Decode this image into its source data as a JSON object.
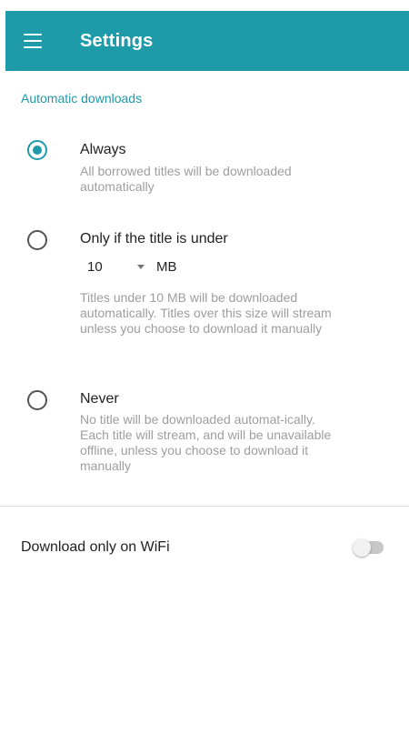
{
  "app_bar": {
    "title": "Settings",
    "background": "#1e9aa9",
    "menu_icon": "hamburger-menu-icon"
  },
  "section": {
    "header": "Automatic downloads"
  },
  "options": [
    {
      "title": "Always",
      "description": "All borrowed titles will be downloaded automatically",
      "selected": true
    },
    {
      "title": "Only if the title is under",
      "description": "Titles under 10 MB will be downloaded automatically. Titles over this size will stream unless you choose to download it manually",
      "selected": false,
      "size_select": {
        "value": "10",
        "unit": "MB"
      }
    },
    {
      "title": "Never",
      "description": "No title will be downloaded automat-ically. Each title will stream, and will be unavailable offline, unless you choose to download it manually",
      "selected": false
    }
  ],
  "wifi": {
    "label": "Download only on WiFi",
    "enabled": false
  },
  "colors": {
    "accent": "#1e9aa9",
    "secondary_text": "#9e9e9e"
  }
}
